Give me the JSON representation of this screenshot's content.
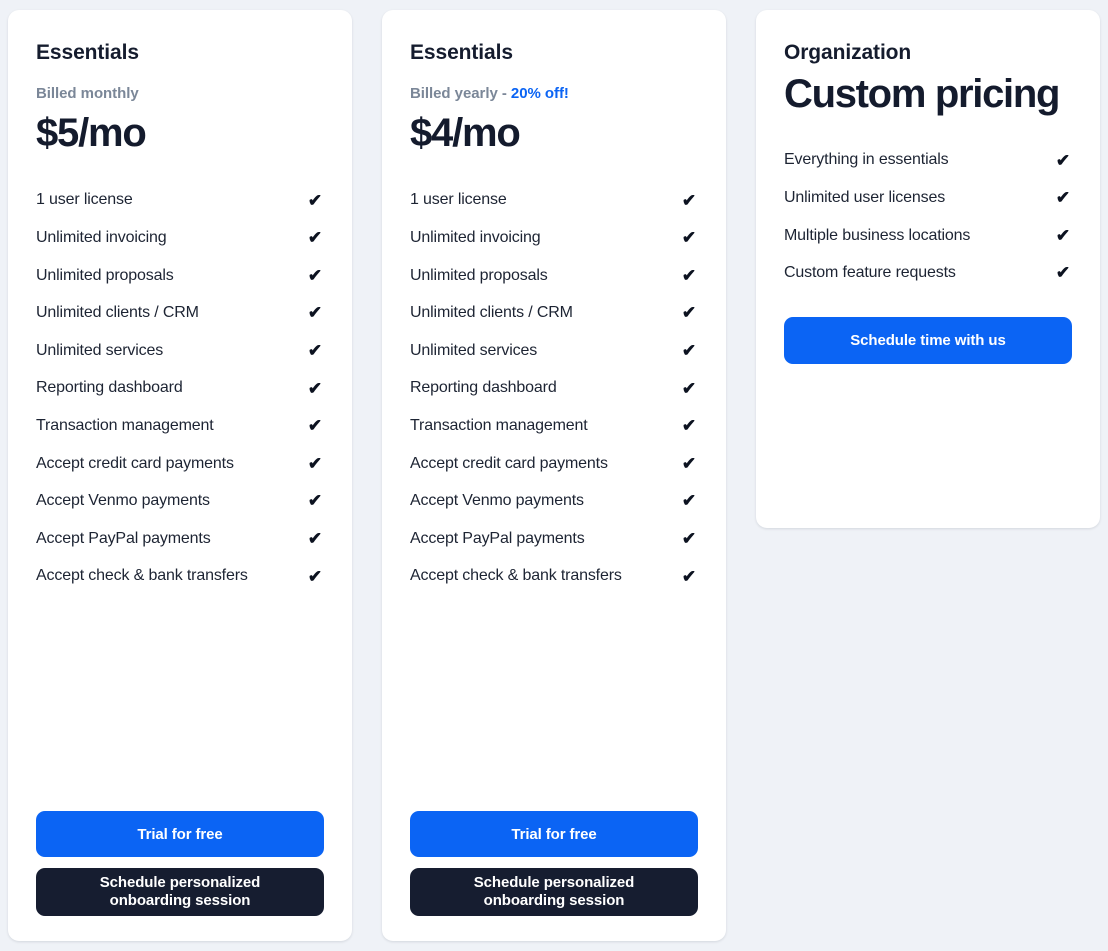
{
  "theme": {
    "page_background": "#eff2f7",
    "card_background": "#ffffff",
    "accent_blue": "#0b64f4",
    "dark_button": "#161d30",
    "heading_color": "#151c2e",
    "muted_text": "#7b8798"
  },
  "icons": {
    "check": "✔"
  },
  "plans": [
    {
      "name": "Essentials",
      "billing_prefix": "Billed monthly",
      "billing_separator": "",
      "billing_discount": "",
      "price": "$5/mo",
      "features": [
        "1 user license",
        "Unlimited invoicing",
        "Unlimited proposals",
        "Unlimited clients / CRM",
        "Unlimited services",
        "Reporting dashboard",
        "Transaction management",
        "Accept credit card payments",
        "Accept Venmo payments",
        "Accept PayPal payments",
        "Accept check & bank transfers"
      ],
      "primary_cta": "Trial for free",
      "secondary_cta": "Schedule personalized\nonboarding session"
    },
    {
      "name": "Essentials",
      "billing_prefix": "Billed yearly",
      "billing_separator": " - ",
      "billing_discount": "20% off!",
      "price": "$4/mo",
      "features": [
        "1 user license",
        "Unlimited invoicing",
        "Unlimited proposals",
        "Unlimited clients / CRM",
        "Unlimited services",
        "Reporting dashboard",
        "Transaction management",
        "Accept credit card payments",
        "Accept Venmo payments",
        "Accept PayPal payments",
        "Accept check & bank transfers"
      ],
      "primary_cta": "Trial for free",
      "secondary_cta": "Schedule personalized\nonboarding session"
    },
    {
      "name": "Organization",
      "billing_prefix": "",
      "billing_separator": "",
      "billing_discount": "",
      "price": "Custom pricing",
      "features": [
        "Everything in essentials",
        "Unlimited user licenses",
        "Multiple business locations",
        "Custom feature requests"
      ],
      "primary_cta": "Schedule time with us",
      "secondary_cta": ""
    }
  ]
}
